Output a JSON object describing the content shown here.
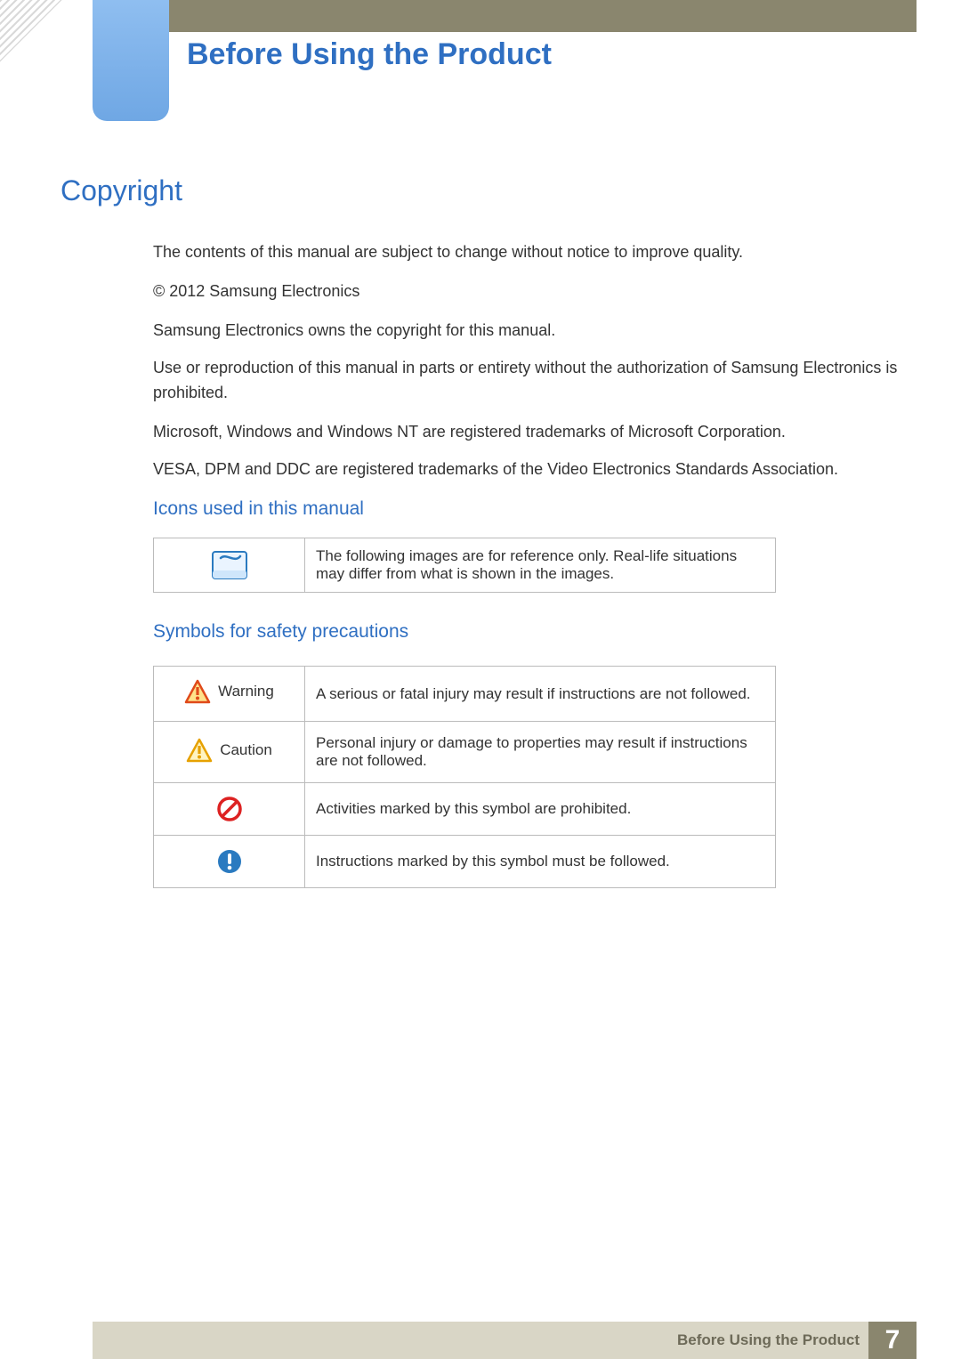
{
  "header": {
    "chapter_title": "Before Using the Product"
  },
  "sections": {
    "copyright": {
      "title": "Copyright",
      "paragraphs": [
        "The contents of this manual are subject to change without notice to improve quality.",
        "© 2012 Samsung Electronics",
        "Samsung Electronics owns the copyright for this manual.",
        "Use or reproduction of this manual in parts or entirety without the authorization of Samsung Electronics is prohibited.",
        "Microsoft, Windows and Windows NT are registered trademarks of Microsoft Corporation.",
        "VESA, DPM and DDC are registered trademarks of the Video Electronics Standards Association."
      ]
    },
    "icons_used": {
      "title": "Icons used in this manual",
      "rows": [
        {
          "icon": "note-icon",
          "text": "The following images are for reference only. Real-life situations may differ from what is shown in the images."
        }
      ]
    },
    "safety_symbols": {
      "title": "Symbols for safety precautions",
      "rows": [
        {
          "icon": "warning-icon",
          "label": "Warning",
          "text": "A serious or fatal injury may result if instructions are not followed."
        },
        {
          "icon": "caution-icon",
          "label": "Caution",
          "text": "Personal injury or damage to properties may result if instructions are not followed."
        },
        {
          "icon": "prohibited-icon",
          "label": "",
          "text": "Activities marked by this symbol are prohibited."
        },
        {
          "icon": "must-follow-icon",
          "label": "",
          "text": "Instructions marked by this symbol must be followed."
        }
      ]
    }
  },
  "footer": {
    "text": "Before Using the Product",
    "page": "7"
  }
}
